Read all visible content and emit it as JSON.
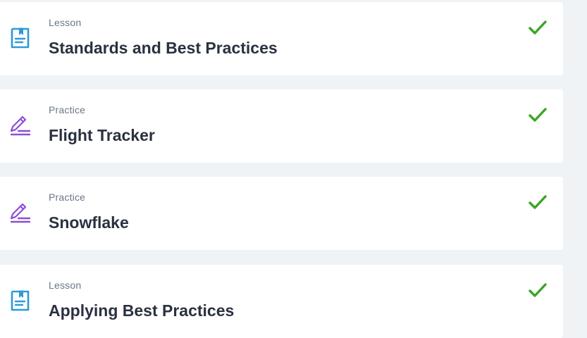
{
  "colors": {
    "page_background": "#f0f3f6",
    "card_background": "#ffffff",
    "lesson_icon": "#2d9ad8",
    "practice_icon": "#8b4fd6",
    "check": "#3aa524",
    "type_text": "#6b7587",
    "title_text": "#2a3140"
  },
  "items": [
    {
      "type": "Lesson",
      "title": "Standards and Best Practices",
      "icon": "lesson-document-icon",
      "status": "completed"
    },
    {
      "type": "Practice",
      "title": "Flight Tracker",
      "icon": "practice-pencil-icon",
      "status": "completed"
    },
    {
      "type": "Practice",
      "title": "Snowflake",
      "icon": "practice-pencil-icon",
      "status": "completed"
    },
    {
      "type": "Lesson",
      "title": "Applying Best Practices",
      "icon": "lesson-document-icon",
      "status": "completed"
    }
  ]
}
